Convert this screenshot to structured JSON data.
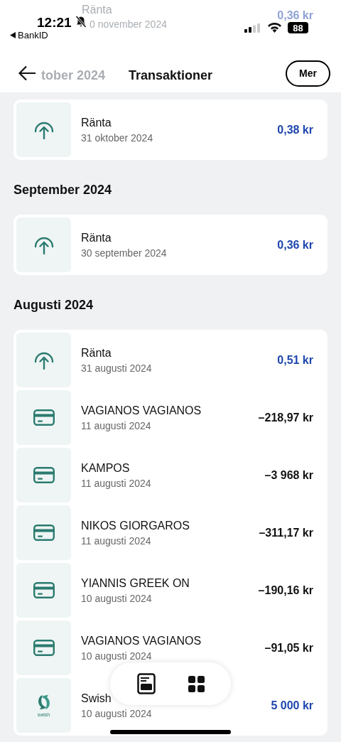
{
  "status_bar": {
    "time": "12:21",
    "back_app": "BankID",
    "battery": "88"
  },
  "scrolled_under": {
    "title": "Ränta",
    "date": "0 november 2024",
    "amount": "0,36 kr",
    "section": "tober 2024"
  },
  "header": {
    "title": "Transaktioner",
    "more_button": "Mer"
  },
  "sections": [
    {
      "rows": [
        {
          "kind": "interest",
          "title": "Ränta",
          "date": "31 oktober 2024",
          "amount": "0,38 kr",
          "credit": true
        }
      ]
    },
    {
      "title": "September 2024",
      "rows": [
        {
          "kind": "interest",
          "title": "Ränta",
          "date": "30 september 2024",
          "amount": "0,36 kr",
          "credit": true
        }
      ]
    },
    {
      "title": "Augusti 2024",
      "rows": [
        {
          "kind": "interest",
          "title": "Ränta",
          "date": "31 augusti 2024",
          "amount": "0,51 kr",
          "credit": true
        },
        {
          "kind": "card",
          "title": "VAGIANOS VAGIANOS",
          "date": "11 augusti 2024",
          "amount": "–218,97 kr",
          "credit": false
        },
        {
          "kind": "card",
          "title": "KAMPOS",
          "date": "11 augusti 2024",
          "amount": "–3 968 kr",
          "credit": false
        },
        {
          "kind": "card",
          "title": "NIKOS GIORGAROS",
          "date": "11 augusti 2024",
          "amount": "–311,17 kr",
          "credit": false
        },
        {
          "kind": "card",
          "title": "YIANNIS GREEK ON",
          "date": "10 augusti 2024",
          "amount": "–190,16 kr",
          "credit": false
        },
        {
          "kind": "card",
          "title": "VAGIANOS VAGIANOS",
          "date": "10 augusti 2024",
          "amount": "–91,05 kr",
          "credit": false
        },
        {
          "kind": "swish",
          "title": "Swish",
          "date": "10 augusti 2024",
          "amount": "5 000 kr",
          "credit": true,
          "logo_text": "swish"
        }
      ]
    }
  ]
}
